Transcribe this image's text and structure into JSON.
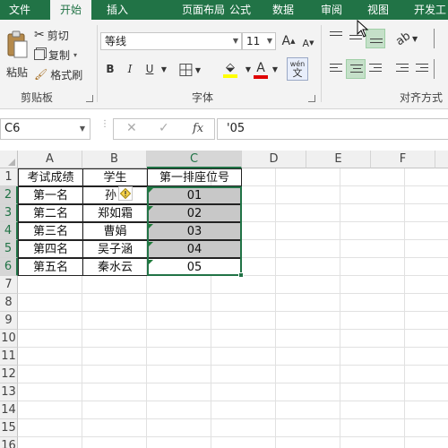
{
  "tabs": [
    "文件",
    "开始",
    "插入",
    "页面布局",
    "公式",
    "数据",
    "审阅",
    "视图",
    "开发工"
  ],
  "active_tab_index": 1,
  "ribbon": {
    "clipboard": {
      "paste": "粘贴",
      "cut": "剪切",
      "copy": "复制",
      "format_painter": "格式刷",
      "group_label": "剪贴板"
    },
    "font": {
      "font_name": "等线",
      "font_size": "11",
      "grow": "A",
      "shrink": "A",
      "bold": "B",
      "italic": "I",
      "underline": "U",
      "font_color_letter": "A",
      "phonetic": "wén",
      "phonetic_sub": "文",
      "group_label": "字体"
    },
    "alignment": {
      "group_label": "对齐方式"
    }
  },
  "formula_bar": {
    "name_box": "C6",
    "cancel_symbol": "✕",
    "enter_symbol": "✓",
    "fx_label": "fx",
    "formula": "'05"
  },
  "columns": [
    "A",
    "B",
    "C",
    "D",
    "E",
    "F"
  ],
  "rows": [
    "1",
    "2",
    "3",
    "4",
    "5",
    "6",
    "7",
    "8",
    "9",
    "10",
    "11",
    "12",
    "13",
    "14",
    "15",
    "16"
  ],
  "sheet": {
    "header": [
      "考试成绩",
      "学生",
      "第一排座位号"
    ],
    "data": [
      [
        "第一名",
        "孙",
        "01"
      ],
      [
        "第二名",
        "郑如霜",
        "02"
      ],
      [
        "第三名",
        "曹娟",
        "03"
      ],
      [
        "第四名",
        "吴子涵",
        "04"
      ],
      [
        "第五名",
        "秦水云",
        "05"
      ]
    ]
  },
  "colors": {
    "brand": "#217346",
    "selection_fill": "#c8c8c8",
    "error_triangle": "#1e7b3a",
    "font_color_bar": "#e00000",
    "fill_color_bar": "#ffff00"
  }
}
